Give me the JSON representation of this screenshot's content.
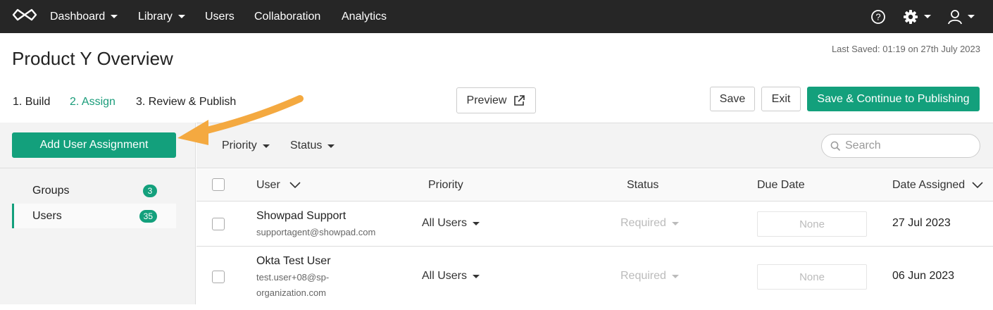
{
  "nav": {
    "items": [
      {
        "label": "Dashboard",
        "dropdown": true
      },
      {
        "label": "Library",
        "dropdown": true
      },
      {
        "label": "Users",
        "dropdown": false
      },
      {
        "label": "Collaboration",
        "dropdown": false
      },
      {
        "label": "Analytics",
        "dropdown": false
      }
    ],
    "icons": [
      "help-icon",
      "gear-icon",
      "user-icon"
    ]
  },
  "header": {
    "title": "Product Y Overview",
    "last_saved": "Last Saved: 01:19 on 27th July 2023"
  },
  "steps": [
    {
      "label": "1. Build",
      "active": false
    },
    {
      "label": "2. Assign",
      "active": true
    },
    {
      "label": "3. Review & Publish",
      "active": false
    }
  ],
  "actions": {
    "preview": "Preview",
    "save": "Save",
    "exit": "Exit",
    "save_continue": "Save & Continue to Publishing"
  },
  "sidebar": {
    "add_button": "Add User Assignment",
    "items": [
      {
        "label": "Groups",
        "count": "3",
        "active": false
      },
      {
        "label": "Users",
        "count": "35",
        "active": true
      }
    ]
  },
  "filters": {
    "priority": "Priority",
    "status": "Status",
    "search_placeholder": "Search"
  },
  "table": {
    "columns": [
      "User",
      "Priority",
      "Status",
      "Due Date",
      "Date Assigned"
    ],
    "rows": [
      {
        "name": "Showpad Support",
        "email": "supportagent@showpad.com",
        "priority": "All Users",
        "status": "Required",
        "due": "None",
        "assigned": "27 Jul 2023"
      },
      {
        "name": "Okta Test User",
        "email_line1": "test.user+08@sp-",
        "email_line2": "organization.com",
        "priority": "All Users",
        "status": "Required",
        "due": "None",
        "assigned": "06 Jun 2023"
      }
    ]
  },
  "colors": {
    "accent": "#13a07c",
    "nav_bg": "#262626",
    "annotation_arrow": "#f4a940"
  }
}
